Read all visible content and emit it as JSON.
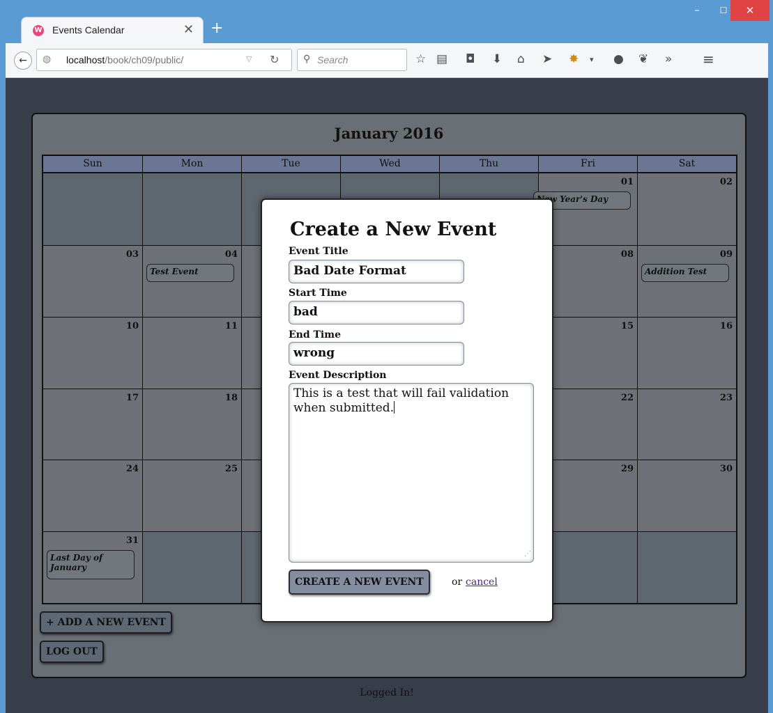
{
  "browser": {
    "tab_title": "Events Calendar",
    "tab_close": "✕",
    "new_tab": "+",
    "url_host": "localhost",
    "url_path": "/book/ch09/public/",
    "search_placeholder": "Search",
    "window_controls": {
      "minimize": "–",
      "maximize": "☐",
      "close": "✕"
    }
  },
  "calendar": {
    "title": "January 2016",
    "weekdays": [
      "Sun",
      "Mon",
      "Tue",
      "Wed",
      "Thu",
      "Fri",
      "Sat"
    ],
    "visible_days": [
      {
        "day": "01",
        "event": "New Year's Day"
      },
      {
        "day": "02"
      },
      {
        "day": "03"
      },
      {
        "day": "04",
        "event": "Test Event"
      },
      {
        "day": "08"
      },
      {
        "day": "09",
        "event": "Addition Test"
      },
      {
        "day": "10"
      },
      {
        "day": "11"
      },
      {
        "day": "15"
      },
      {
        "day": "16"
      },
      {
        "day": "17"
      },
      {
        "day": "18"
      },
      {
        "day": "22"
      },
      {
        "day": "23"
      },
      {
        "day": "24"
      },
      {
        "day": "25"
      },
      {
        "day": "29"
      },
      {
        "day": "30"
      },
      {
        "day": "31",
        "event": "Last Day of January"
      }
    ],
    "add_event_button": "+ ADD A NEW EVENT",
    "logout_button": "LOG OUT",
    "status": "Logged In!"
  },
  "modal": {
    "title": "Create a New Event",
    "event_title_label": "Event Title",
    "event_title_value": "Bad Date Format",
    "start_time_label": "Start Time",
    "start_time_value": "bad",
    "end_time_label": "End Time",
    "end_time_value": "wrong",
    "description_label": "Event Description",
    "description_value": "This is a test that will fail validation when submitted.",
    "submit_button": "CREATE A NEW EVENT",
    "or_text": "or",
    "cancel_link": "cancel"
  }
}
